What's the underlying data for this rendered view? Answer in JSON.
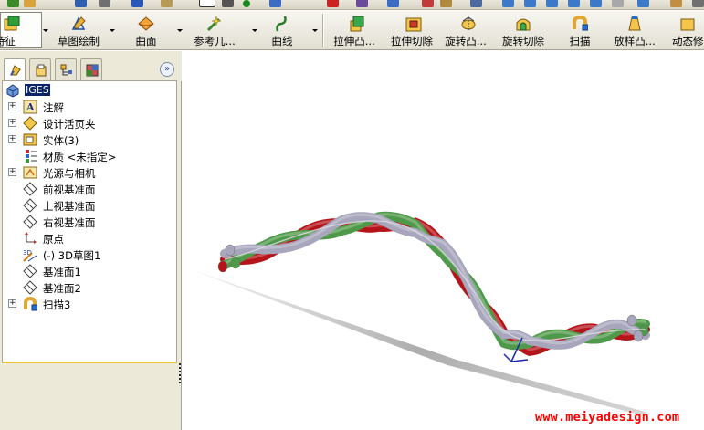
{
  "toolbar": {
    "buttons": [
      {
        "id": "feature",
        "label": "特征",
        "icon": "feature-icon"
      },
      {
        "id": "sketch",
        "label": "草图绘制",
        "icon": "sketch-icon"
      },
      {
        "id": "surface",
        "label": "曲面",
        "icon": "surface-icon"
      },
      {
        "id": "reference",
        "label": "参考几...",
        "icon": "reference-geometry-icon"
      },
      {
        "id": "curve",
        "label": "曲线",
        "icon": "curve-icon"
      },
      {
        "id": "extrude-boss",
        "label": "拉伸凸...",
        "icon": "extrude-boss-icon"
      },
      {
        "id": "extrude-cut",
        "label": "拉伸切除",
        "icon": "extrude-cut-icon"
      },
      {
        "id": "revolve-boss",
        "label": "旋转凸...",
        "icon": "revolve-boss-icon"
      },
      {
        "id": "revolve-cut",
        "label": "旋转切除",
        "icon": "revolve-cut-icon"
      },
      {
        "id": "sweep",
        "label": "扫描",
        "icon": "sweep-icon"
      },
      {
        "id": "loft",
        "label": "放样凸...",
        "icon": "loft-icon"
      },
      {
        "id": "dynamic",
        "label": "动态修",
        "icon": "dynamic-icon"
      }
    ]
  },
  "panel": {
    "tabs": [
      "feature-manager-icon",
      "property-manager-icon",
      "configuration-manager-icon",
      "display-manager-icon"
    ],
    "collapse": "»"
  },
  "tree": {
    "root": "IGES",
    "items": [
      {
        "label": "注解",
        "icon": "annotation-icon",
        "expand": "+"
      },
      {
        "label": "设计活页夹",
        "icon": "design-binder-icon",
        "expand": "+"
      },
      {
        "label": "实体(3)",
        "icon": "solid-bodies-icon",
        "expand": "+"
      },
      {
        "label": "材质 <未指定>",
        "icon": "material-icon",
        "expand": ""
      },
      {
        "label": "光源与相机",
        "icon": "lights-cameras-icon",
        "expand": "+"
      },
      {
        "label": "前视基准面",
        "icon": "plane-icon",
        "expand": ""
      },
      {
        "label": "上视基准面",
        "icon": "plane-icon",
        "expand": ""
      },
      {
        "label": "右视基准面",
        "icon": "plane-icon",
        "expand": ""
      },
      {
        "label": "原点",
        "icon": "origin-icon",
        "expand": ""
      },
      {
        "label": "(-) 3D草图1",
        "icon": "sketch3d-icon",
        "expand": ""
      },
      {
        "label": "基准面1",
        "icon": "plane-icon",
        "expand": ""
      },
      {
        "label": "基准面2",
        "icon": "plane-icon",
        "expand": ""
      },
      {
        "label": "扫描3",
        "icon": "sweep-feature-icon",
        "expand": "+"
      }
    ]
  },
  "viewport": {
    "watermark": "www.meiyadesign.com",
    "strand_colors": {
      "red": "#b5151a",
      "green": "#4f9a4a",
      "silver": "#a7a6bd"
    }
  }
}
